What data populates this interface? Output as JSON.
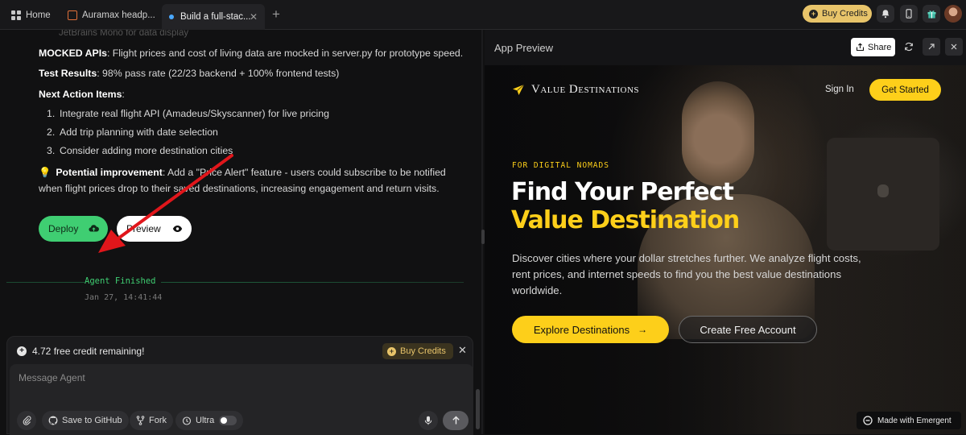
{
  "tabs": [
    {
      "label": "Home"
    },
    {
      "label": "Auramax headp..."
    },
    {
      "label": "Build a full-stac..."
    }
  ],
  "topbar": {
    "buy_credits": "Buy Credits"
  },
  "chat": {
    "faded_line": "JetBrains Mono for data display",
    "mocked_label": "MOCKED APIs",
    "mocked_text": ": Flight prices and cost of living data are mocked in server.py for prototype speed.",
    "tests_label": "Test Results",
    "tests_text": ": 98% pass rate (22/23 backend + 100% frontend tests)",
    "next_label": "Next Action Items",
    "next_colon": ":",
    "items": [
      "Integrate real flight API (Amadeus/Skyscanner) for live pricing",
      "Add trip planning with date selection",
      "Consider adding more destination cities"
    ],
    "improve_emoji": "💡",
    "improve_label": "Potential improvement",
    "improve_text": ": Add a \"Price Alert\" feature - users could subscribe to be notified when flight prices drop to their saved destinations, increasing engagement and return visits.",
    "deploy_label": "Deploy",
    "preview_label": "Preview",
    "finished_label": "Agent Finished",
    "finished_time": "Jan 27, 14:41:44"
  },
  "composer": {
    "credit_text": "4.72 free credit remaining!",
    "buy_credits": "Buy Credits",
    "placeholder": "Message Agent",
    "github_label": "Save to GitHub",
    "fork_label": "Fork",
    "ultra_label": "Ultra"
  },
  "preview": {
    "title": "App Preview",
    "share_label": "Share",
    "site": {
      "brand": "Value Destinations",
      "signin": "Sign In",
      "get_started": "Get Started",
      "eyebrow": "FOR DIGITAL NOMADS",
      "headline_1": "Find Your Perfect",
      "headline_2": "Value Destination",
      "subtitle": "Discover cities where your dollar stretches further. We analyze flight costs, rent prices, and internet speeds to find you the best value destinations worldwide.",
      "explore_label": "Explore Destinations",
      "create_label": "Create Free Account",
      "made_with": "Made with Emergent"
    }
  },
  "colors": {
    "accent_green": "#3fce72",
    "accent_yellow": "#fdcf1a",
    "credit_gold": "#e8c46a",
    "annotation_arrow": "#e0161b"
  },
  "icons": [
    "home-icon",
    "tab-icon",
    "tab-dot-icon",
    "close-icon",
    "plus-icon",
    "coin-icon",
    "bell-icon",
    "phone-icon",
    "gift-icon",
    "cloud-upload-icon",
    "eye-icon",
    "attach-icon",
    "github-icon",
    "fork-icon",
    "ultra-icon",
    "mic-icon",
    "send-icon",
    "share-icon",
    "refresh-icon",
    "expand-icon",
    "plane-icon",
    "arrow-right-icon",
    "emergent-icon"
  ]
}
